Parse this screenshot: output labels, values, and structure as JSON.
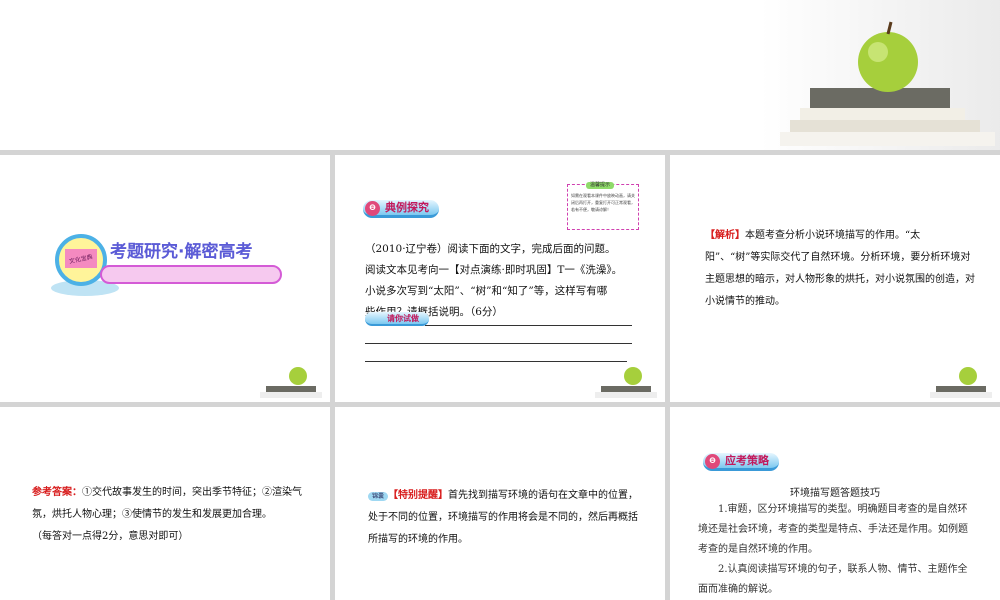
{
  "slide1": {
    "title": "考题研究·解密高考",
    "icon_label": "文化宝典"
  },
  "slide2": {
    "badge": "典例探究",
    "note_title": "温馨提示",
    "note_text": "如需在观看本课件中放映动画，请关闭后再打开，重复打开可正常观看，若有不便，敬请谅解！",
    "lines": [
      "（2010·辽宁卷）阅读下面的文字，完成后面的问题。",
      "阅读文本见考向一【对点演练·即时巩固】T一《洗澡》。",
      "小说多次写到“太阳”、“树”和“知了”等，这样写有哪",
      "些作用？请概括说明。（6分）"
    ],
    "try_label": "请你试做"
  },
  "slide3": {
    "label": "【解析】",
    "text": "本题考查分析小说环境描写的作用。“太阳”、“树”等实际交代了自然环境。分析环境，要分析环境对主题思想的暗示，对人物形象的烘托，对小说氛围的创造，对小说情节的推动。"
  },
  "slide4": {
    "label": "参考答案：",
    "text": "①交代故事发生的时间，突出季节特征；②渲染气氛，烘托人物心理；③使情节的发生和发展更加合理。",
    "note": "（每答对一点得2分，意思对即可）"
  },
  "slide5": {
    "tag": "锦囊",
    "label": "【特别提醒】",
    "text": "首先找到描写环境的语句在文章中的位置，处于不同的位置，环境描写的作用将会是不同的，然后再概括所描写的环境的作用。"
  },
  "slide6": {
    "badge": "应考策略",
    "heading": "环境描写题答题技巧",
    "p1": "1.审题，区分环境描写的类型。明确题目考查的是自然环境还是社会环境，考查的类型是特点、手法还是作用。如例题考查的是自然环境的作用。",
    "p2": "2.认真阅读描写环境的句子，联系人物、情节、主题作全面而准确的解说。"
  }
}
